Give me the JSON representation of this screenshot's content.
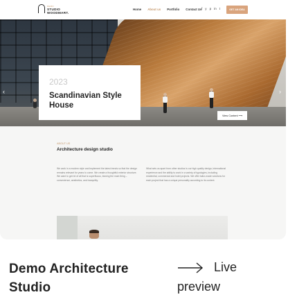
{
  "site": {
    "logo_small": "DEMO",
    "logo_line1": "STUDIO",
    "logo_line2": "WOODMART.",
    "nav": [
      "Home",
      "About us",
      "Portfolio",
      "Contact Us"
    ],
    "nav_active": "About us",
    "socials": [
      "f",
      "y",
      "p",
      "in",
      "t"
    ],
    "cta_label": "GET AN IDEA"
  },
  "hero": {
    "year": "2023",
    "title": "Scandinavian Style House",
    "prev_arrow": "‹",
    "next_arrow": "›",
    "view_button": "View Content ⟶"
  },
  "about": {
    "label": "ABOUT US",
    "title": "Architecture design studio",
    "para_left": "We work in a modern style and implement the latest trends so that the design remains relevant for years to come. We create a thoughtful exterior structure. We want to get rid of all that is superfluous, leaving the main thing – convenience, aesthetics, and tranquility.",
    "para_right": "What sets us apart from other studios is our high quality design, international experience and the ability to work in a variety of typologies, including residential, commercial and hotel projects. We offer tailor-made solutions for each project that has a unique personality according to its context."
  },
  "caption": {
    "title": "Demo Architecture Studio",
    "live_top": "Live",
    "live_bottom": "preview"
  }
}
